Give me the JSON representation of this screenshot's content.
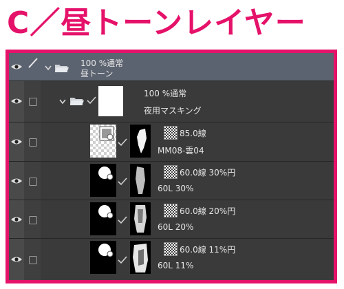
{
  "page": {
    "title": "C／昼トーンレイヤー"
  },
  "layers": [
    {
      "line1": "100 %通常",
      "line2": "昼トーン"
    },
    {
      "line1": "100 %通常",
      "line2": "夜用マスキング"
    },
    {
      "line1": "85.0線",
      "line2": "MM08-雲04"
    },
    {
      "line1": "60.0線 30%円",
      "line2": "60L 30%"
    },
    {
      "line1": "60.0線 20%円",
      "line2": "60L 20%"
    },
    {
      "line1": "60.0線 11%円",
      "line2": "60L 11%"
    }
  ],
  "colors": {
    "accent": "#e5126a",
    "panel": "#3a3a3a",
    "selected": "#5c6370"
  },
  "icons": [
    "eye-icon",
    "pen-icon",
    "chevron-down-icon",
    "folder-open-icon",
    "check-icon",
    "tone-screen-icon",
    "mask-link-icon"
  ]
}
